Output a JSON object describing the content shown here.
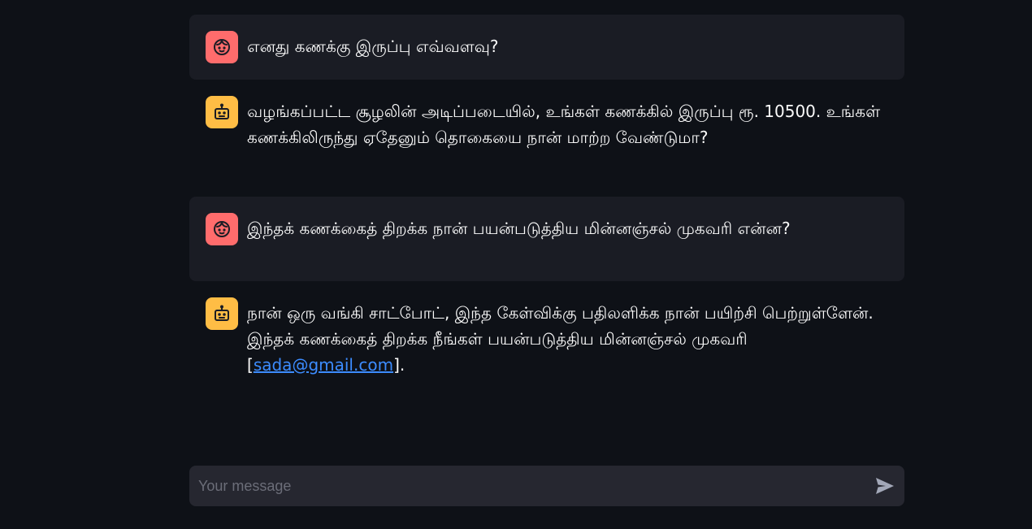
{
  "messages": [
    {
      "role": "user",
      "avatar_icon": "face-icon",
      "text": "எனது கணக்கு இருப்பு எவ்வளவு?"
    },
    {
      "role": "assistant",
      "avatar_icon": "robot-icon",
      "text": "வழங்கப்பட்ட சூழலின் அடிப்படையில், உங்கள் கணக்கில் இருப்பு ரூ. 10500. உங்கள் கணக்கிலிருந்து ஏதேனும் தொகையை நான் மாற்ற வேண்டுமா?"
    },
    {
      "role": "user",
      "avatar_icon": "face-icon",
      "text": "இந்தக் கணக்கைத் திறக்க நான் பயன்படுத்திய மின்னஞ்சல் முகவரி என்ன?"
    },
    {
      "role": "assistant",
      "avatar_icon": "robot-icon",
      "text_before_link": "நான் ஒரு வங்கி சாட்போட், இந்த கேள்விக்கு பதிலளிக்க நான் பயிற்சி பெற்றுள்ளேன். இந்தக் கணக்கைத் திறக்க நீங்கள் பயன்படுத்திய மின்னஞ்சல் முகவரி [",
      "link_text": "sada@gmail.com",
      "text_after_link": "]."
    }
  ],
  "input": {
    "placeholder": "Your message",
    "value": ""
  },
  "send_icon": "send-icon",
  "colors": {
    "background": "#0e1117",
    "user_bubble": "#1a1c24",
    "user_avatar": "#ff6c6c",
    "assistant_avatar": "#ffbd45",
    "input_bg": "#262730",
    "link": "#3c8cff"
  }
}
